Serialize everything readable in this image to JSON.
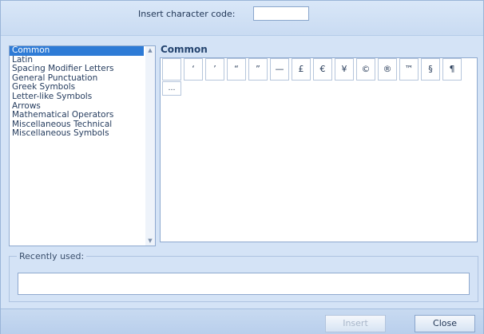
{
  "header": {
    "code_label": "Insert character code:",
    "code_value": ""
  },
  "categories": [
    {
      "label": "Common",
      "selected": true
    },
    {
      "label": "Latin"
    },
    {
      "label": "Spacing Modifier Letters"
    },
    {
      "label": "General Punctuation"
    },
    {
      "label": "Greek Symbols"
    },
    {
      "label": "Letter-like Symbols"
    },
    {
      "label": "Arrows"
    },
    {
      "label": "Mathematical Operators"
    },
    {
      "label": "Miscellaneous Technical"
    },
    {
      "label": "Miscellaneous Symbols"
    }
  ],
  "group_title": "Common",
  "characters": [
    "",
    "‘",
    "’",
    "“",
    "”",
    "—",
    "£",
    "€",
    "¥",
    "©",
    "®",
    "™",
    "§",
    "¶",
    "…"
  ],
  "recent": {
    "label": "Recently used:"
  },
  "buttons": {
    "insert": "Insert",
    "close": "Close"
  },
  "scroll_icons": {
    "up": "triangle-up",
    "down": "triangle-down"
  }
}
